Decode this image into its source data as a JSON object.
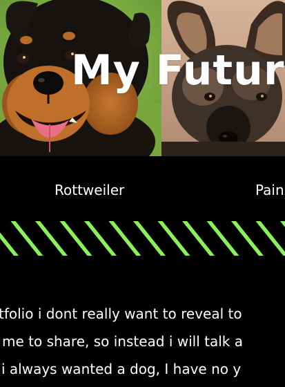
{
  "hero": {
    "title": "My Future",
    "photos": [
      {
        "name": "rottweiler-photo",
        "icon": "rottweiler-dog-image"
      },
      {
        "name": "painted-dog-photo",
        "icon": "african-painted-dog-image"
      }
    ]
  },
  "captions": [
    "Rottweiler",
    "Pain"
  ],
  "divider": {
    "stripe_color": "#8bf05a",
    "background_color": "#000000"
  },
  "body": {
    "lines": [
      "tfolio i dont really want to reveal to",
      " me to share, so instead i will talk a",
      " i always wanted a dog, I have no y"
    ]
  },
  "colors": {
    "background": "#000000",
    "text": "#ffffff",
    "accent": "#8bf05a"
  }
}
